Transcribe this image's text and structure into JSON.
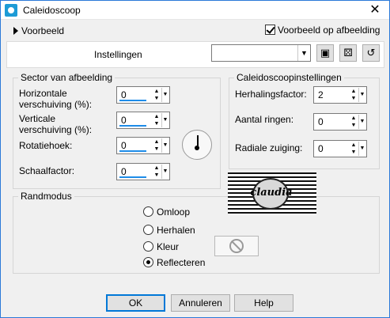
{
  "window": {
    "title": "Caleidoscoop",
    "close_glyph": "✕"
  },
  "preview": {
    "toggle_label": "Voorbeeld",
    "checkbox_label": "Voorbeeld op afbeelding",
    "checked": true
  },
  "settings": {
    "label": "Instellingen",
    "preset_value": ""
  },
  "sector": {
    "title": "Sector van afbeelding",
    "horizontal_label": "Horizontale verschuiving (%):",
    "horizontal_value": "0",
    "vertical_label": "Verticale verschuiving (%):",
    "vertical_value": "0",
    "rotation_label": "Rotatiehoek:",
    "rotation_value": "0",
    "scale_label": "Schaalfactor:",
    "scale_value": "0"
  },
  "kaleido": {
    "title": "Caleidoscoopinstellingen",
    "repeat_label": "Herhalingsfactor:",
    "repeat_value": "2",
    "rings_label": "Aantal ringen:",
    "rings_value": "0",
    "radial_label": "Radiale zuiging:",
    "radial_value": "0"
  },
  "edge_mode": {
    "title": "Randmodus",
    "options": [
      "Omloop",
      "Herhalen",
      "Kleur",
      "Reflecteren"
    ],
    "selected": "Reflecteren"
  },
  "watermark_text": "claudia",
  "buttons": {
    "ok": "OK",
    "cancel": "Annuleren",
    "help": "Help"
  }
}
